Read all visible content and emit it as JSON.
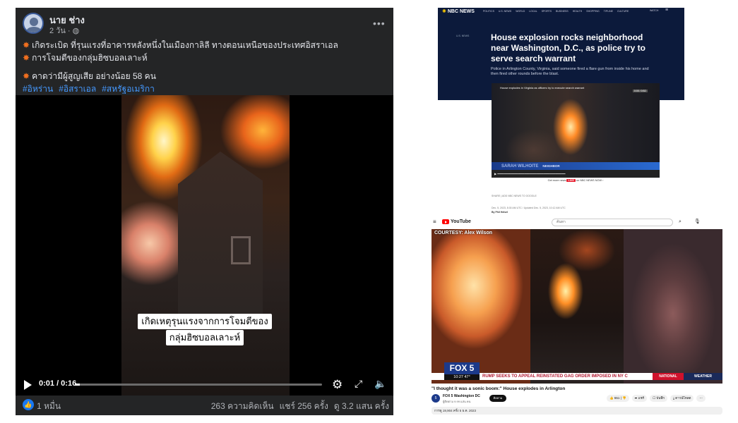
{
  "facebook": {
    "author": "นาย ช่าง",
    "time": "2 วัน · ",
    "line1": "เกิดระเบิด ที่รุนแรงที่อาคารหลังหนึ่งในเมืองกาลิลี ทางตอนเหนือของประเทศอิสราเอล",
    "line2": "การโจมตีของกลุ่มฮิซบอลเลาะห์",
    "line3": "คาดว่ามีผู้สูญเสีย อย่างน้อย 58 คน",
    "hashtags": [
      "#อิหร่าน",
      "#อิสราเอล",
      "#สหรัฐอเมริกา"
    ],
    "subtitle_line1": "เกิดเหตุรุนแรงจากการโจมตีของ",
    "subtitle_line2": "กลุ่มฮิซบอลเลาะห์",
    "timecode": "0:01 / 0:16",
    "progress": 0.02,
    "likes": "1 หมื่น",
    "comments": "263 ความคิดเห็น",
    "shares": "แชร์ 256 ครั้ง",
    "views": "ดู 3.2 แสน ครั้ง",
    "icons": {
      "more": "more-icon",
      "play": "play-icon",
      "gear": "gear-icon",
      "expand": "expand-icon",
      "mute": "mute-icon",
      "like": "like-icon",
      "globe": "globe-icon",
      "boom": "collision-icon"
    }
  },
  "nbc": {
    "logo": "NBC NEWS",
    "nav": [
      "POLITICS",
      "U.S. NEWS",
      "WORLD",
      "LOCAL",
      "SPORTS",
      "BUSINESS",
      "HEALTH",
      "SHOPPING",
      "TIPLINE",
      "CULTURE"
    ],
    "watch": "WATCH",
    "category": "U.S. NEWS",
    "headline": "House explosion rocks neighborhood near Washington, D.C., as police try to serve search warrant",
    "dek": "Police in Arlington County, Virginia, said someone fired a flare gun from inside his home and then fired other rounds before the blast.",
    "video_title": "House explodes in Virginia as officers try to execute search warrant",
    "video_badge": "0:00 / 0:52",
    "lower_third_name": "SARAH WILHOITE",
    "lower_third_role": "NEIGHBOR",
    "more_text": "Get more news",
    "more_badge": "LIVE",
    "more_suffix": "on NBC NEWS NOW",
    "share": "SHARE",
    "add_nbc": "ADD NBC NEWS TO GOOGLE",
    "date": "Dec. 5, 2023, 8:30 AM UTC / Updated Dec. 5, 2023, 10:12 AM UTC",
    "byline": "By Phil Helsel"
  },
  "youtube": {
    "logo": "YouTube",
    "search_placeholder": "ค้นหา",
    "courtesy": "COURTESY: Alex Wilson",
    "channel_logo": "FOX 5",
    "clock": "10:27  47°",
    "ticker": "RUMP SEEKS TO APPEAL REINSTATED GAG ORDER IMPOSED IN NY C",
    "national": "NATIONAL",
    "weather": "WEATHER",
    "title": "\"I thought it was a sonic boom:\" House explodes in Arlington",
    "channel": "FOX 5 Washington DC",
    "subscribers": "ผู้ติดตาม 9.99 แสน คน",
    "subscribe": "ติดตาม",
    "likes": "551",
    "share": "แชร์",
    "save": "บันทึก",
    "download": "ดาวน์โหลด",
    "description": "การดู 19,904 ครั้ง 5 ธ.ค. 2023"
  }
}
